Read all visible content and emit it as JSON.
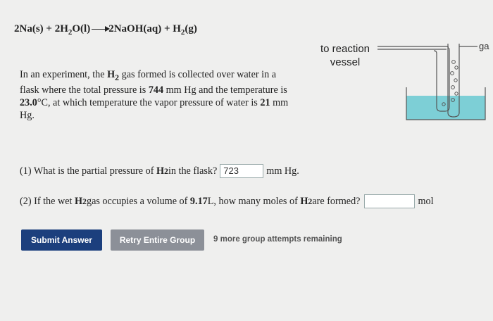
{
  "equation": {
    "part1": "2Na(s) + 2H",
    "sub1": "2",
    "part2": "O(l)",
    "part3": "2NaOH(aq) + H",
    "sub2": "2",
    "part4": "(g)"
  },
  "diagram": {
    "label_reaction": "to reaction vessel",
    "label_gas": "ga",
    "colors": {
      "water": "#7dcfd6",
      "line": "#555555"
    }
  },
  "problem": {
    "t1": "In an experiment, the ",
    "h": "H",
    "h_sub": "2",
    "t2": " gas formed is collected over water in a flask where the total pressure is ",
    "pressure": "744",
    "t3": " mm Hg and the temperature is ",
    "temp": "23.0",
    "t4": "°C, at which temperature the vapor pressure of water is ",
    "vapor": "21",
    "t5": " mm Hg."
  },
  "q1": {
    "prefix": "(1) What is the partial pressure of ",
    "h": "H",
    "h_sub": "2",
    "suffix": " in the flask?",
    "value": "723",
    "unit": "mm Hg."
  },
  "q2": {
    "prefix": "(2) If the wet ",
    "h": "H",
    "h_sub": "2",
    "middle": " gas occupies a volume of ",
    "volume": "9.17",
    "middle2": " L, how many moles of ",
    "h2": "H",
    "h2_sub": "2",
    "suffix": " are formed?",
    "value": "",
    "unit": "mol"
  },
  "buttons": {
    "submit": "Submit Answer",
    "retry": "Retry Entire Group",
    "attempts": "9 more group attempts remaining"
  },
  "colors": {
    "submit_bg": "#1c3f7d",
    "retry_bg": "#8c9098",
    "page_bg": "#efefee"
  }
}
